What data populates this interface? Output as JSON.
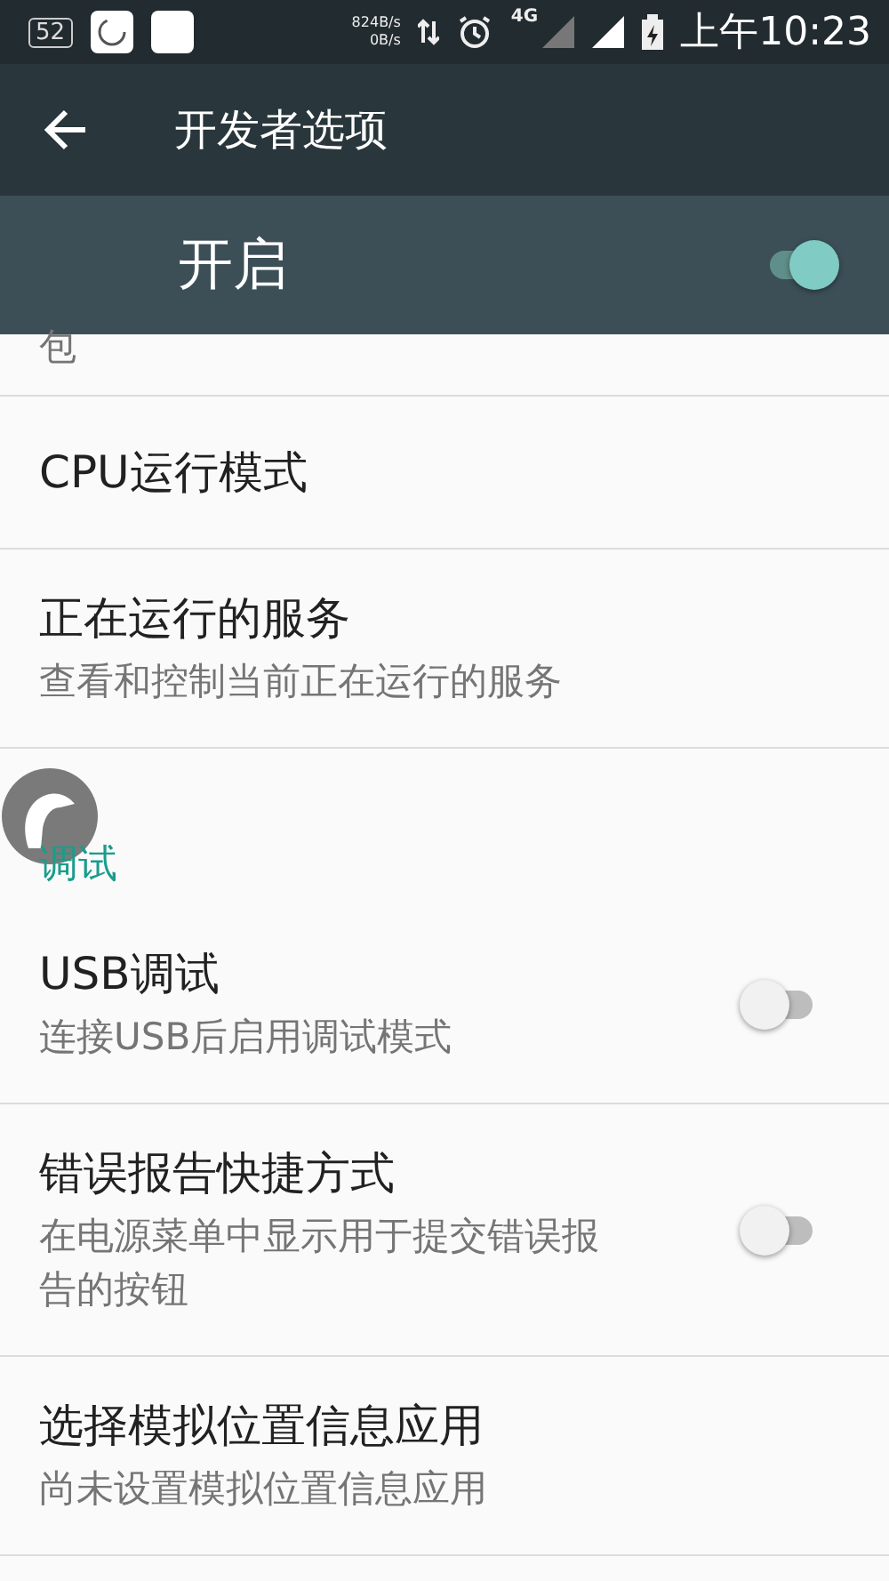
{
  "status_bar": {
    "battery_badge": "52",
    "speed_up": "824B/s",
    "speed_down": "0B/s",
    "network": "4G",
    "time": "上午10:23"
  },
  "toolbar": {
    "title": "开发者选项"
  },
  "master_switch": {
    "label": "开启",
    "on": true
  },
  "list": [
    {
      "kind": "item",
      "summary": "包"
    },
    {
      "kind": "item",
      "title": "CPU运行模式"
    },
    {
      "kind": "item",
      "title": "正在运行的服务",
      "summary": "查看和控制当前正在运行的服务"
    },
    {
      "kind": "header",
      "title": "调试"
    },
    {
      "kind": "switch",
      "title": "USB调试",
      "summary": "连接USB后启用调试模式",
      "on": false
    },
    {
      "kind": "switch",
      "title": "错误报告快捷方式",
      "summary": "在电源菜单中显示用于提交错误报告的按钮",
      "on": false
    },
    {
      "kind": "item",
      "title": "选择模拟位置信息应用",
      "summary": "尚未设置模拟位置信息应用"
    }
  ]
}
